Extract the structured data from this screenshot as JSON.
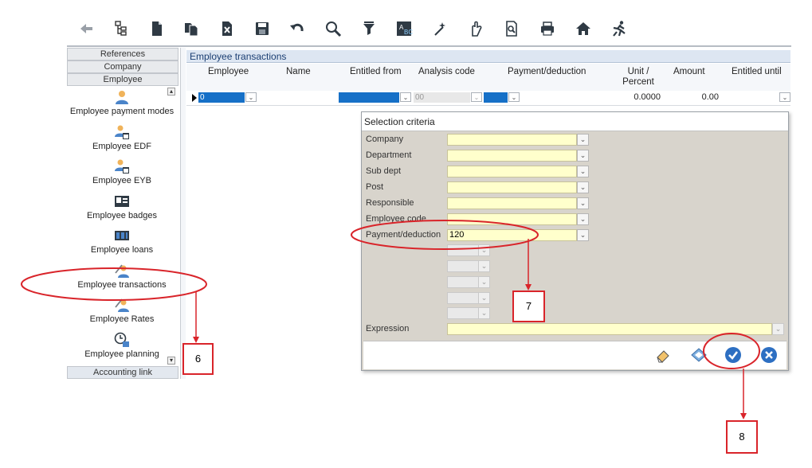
{
  "toolbar": {
    "icons": [
      "back-icon",
      "tree-icon",
      "document-icon",
      "copy-document-icon",
      "delete-document-icon",
      "save-icon",
      "undo-icon",
      "search-icon",
      "filter-icon",
      "abc-field-icon",
      "magic-wand-icon",
      "hand-select-icon",
      "preview-icon",
      "print-icon",
      "home-icon",
      "exit-run-icon"
    ]
  },
  "left_panel": {
    "sections": {
      "references": "References",
      "company": "Company",
      "employee": "Employee",
      "accounting_link": "Accounting link"
    },
    "items": [
      {
        "label": "Employee payment modes",
        "icon": "person-icon"
      },
      {
        "label": "Employee EDF",
        "icon": "person-calendar-icon"
      },
      {
        "label": "Employee EYB",
        "icon": "person-calendar-icon"
      },
      {
        "label": "Employee badges",
        "icon": "badge-icon"
      },
      {
        "label": "Employee loans",
        "icon": "loan-icon"
      },
      {
        "label": "Employee transactions",
        "icon": "person-pen-icon"
      },
      {
        "label": "Employee Rates",
        "icon": "person-pen-icon"
      },
      {
        "label": "Employee planning",
        "icon": "clock-icon"
      }
    ]
  },
  "grid": {
    "title": "Employee transactions",
    "columns": [
      "Employee",
      "Name",
      "Entitled from",
      "Analysis code",
      "Payment/deduction",
      "Unit /\nPercent",
      "Amount",
      "Entitled until"
    ],
    "row": {
      "employee": "0",
      "analysis_code": "00",
      "unit_percent": "0.0000",
      "amount": "0.00"
    }
  },
  "dialog": {
    "title": "Selection criteria",
    "criteria": [
      {
        "label": "Company",
        "value": ""
      },
      {
        "label": "Department",
        "value": ""
      },
      {
        "label": "Sub dept",
        "value": ""
      },
      {
        "label": "Post",
        "value": ""
      },
      {
        "label": "Responsible",
        "value": ""
      },
      {
        "label": "Employee code",
        "value": ""
      },
      {
        "label": "Payment/deduction",
        "value": "120"
      }
    ],
    "expression_label": "Expression",
    "footer_icons": [
      "eraser-icon",
      "save-criteria-icon",
      "confirm-check-icon",
      "cancel-close-icon"
    ]
  },
  "annotations": {
    "step6": "6",
    "step7": "7",
    "step8": "8"
  },
  "colors": {
    "accent_blue": "#1670c7",
    "field_yellow": "#ffffcc",
    "annotation_red": "#d9242a"
  }
}
